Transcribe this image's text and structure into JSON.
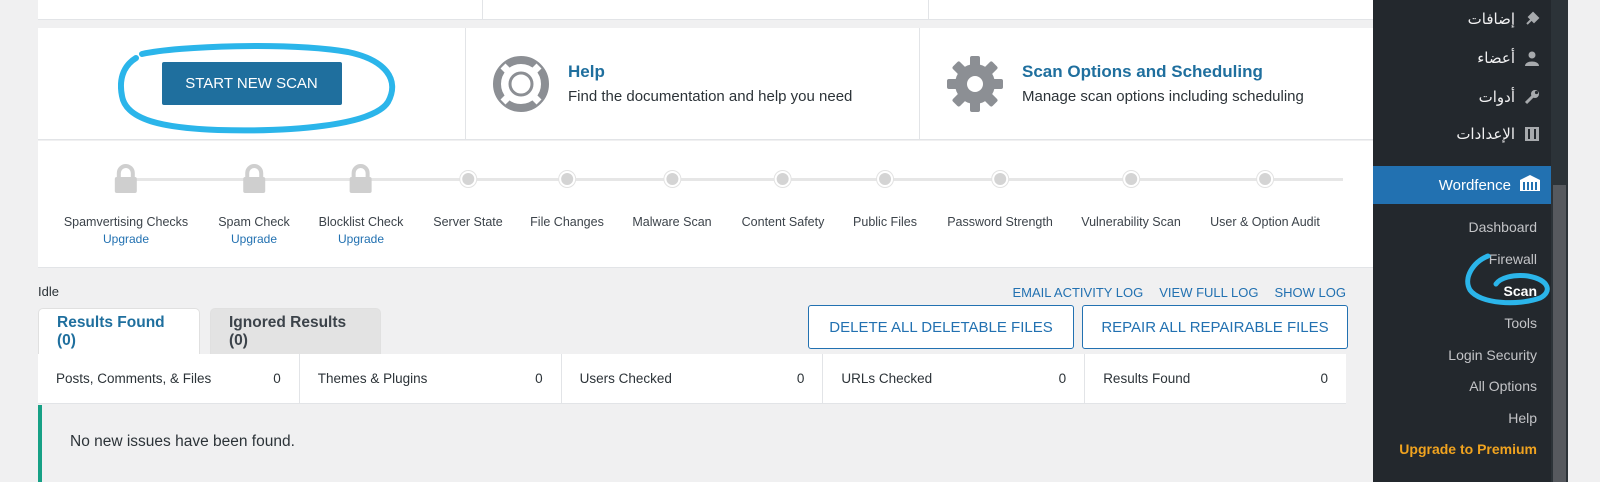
{
  "actions": {
    "start_scan": "START NEW SCAN",
    "help": {
      "title": "Help",
      "desc": "Find the documentation and help you need"
    },
    "options": {
      "title": "Scan Options and Scheduling",
      "desc": "Manage scan options including scheduling"
    }
  },
  "stages": [
    {
      "label": "Spamvertising Checks",
      "upgrade": "Upgrade",
      "locked": true
    },
    {
      "label": "Spam Check",
      "upgrade": "Upgrade",
      "locked": true
    },
    {
      "label": "Blocklist Check",
      "upgrade": "Upgrade",
      "locked": true
    },
    {
      "label": "Server State",
      "locked": false
    },
    {
      "label": "File Changes",
      "locked": false
    },
    {
      "label": "Malware Scan",
      "locked": false
    },
    {
      "label": "Content Safety",
      "locked": false
    },
    {
      "label": "Public Files",
      "locked": false
    },
    {
      "label": "Password Strength",
      "locked": false
    },
    {
      "label": "Vulnerability Scan",
      "locked": false
    },
    {
      "label": "User & Option Audit",
      "locked": false
    }
  ],
  "status": "Idle",
  "log_links": [
    "EMAIL ACTIVITY LOG",
    "VIEW FULL LOG",
    "SHOW LOG"
  ],
  "tabs": [
    "Results Found (0)",
    "Ignored Results (0)"
  ],
  "bulk": {
    "delete": "DELETE ALL DELETABLE FILES",
    "repair": "REPAIR ALL REPAIRABLE FILES"
  },
  "summary": [
    {
      "label": "Posts, Comments, & Files",
      "value": "0"
    },
    {
      "label": "Themes & Plugins",
      "value": "0"
    },
    {
      "label": "Users Checked",
      "value": "0"
    },
    {
      "label": "URLs Checked",
      "value": "0"
    },
    {
      "label": "Results Found",
      "value": "0"
    }
  ],
  "issues_message": "No new issues have been found.",
  "sidebar": {
    "menu_ar": [
      "إضافات",
      "أعضاء",
      "أدوات",
      "الإعدادات"
    ],
    "wordfence": "Wordfence",
    "submenu": [
      "Dashboard",
      "Firewall",
      "Scan",
      "Tools",
      "Login Security",
      "All Options",
      "Help"
    ],
    "premium": "Upgrade to Premium"
  },
  "colors": {
    "accent": "#1f6f9e",
    "link": "#2271b1",
    "sidebar": "#23282d",
    "annotation": "#2bb5ea",
    "premium": "#f0a31f"
  }
}
